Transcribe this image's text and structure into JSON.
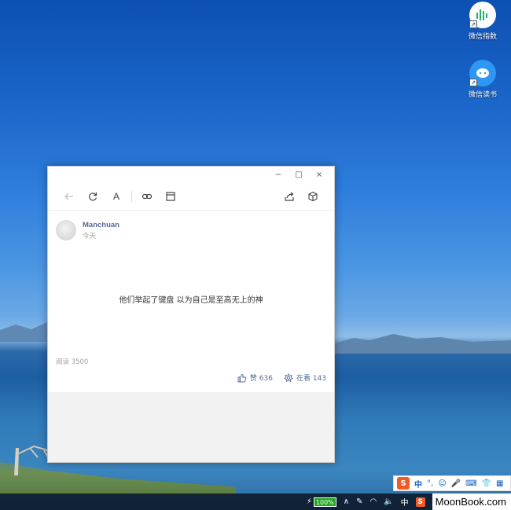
{
  "desktop": {
    "icons": [
      {
        "label": "微信指数",
        "icon": "wechat-index-icon"
      },
      {
        "label": "微信读书",
        "icon": "wechat-read-icon"
      }
    ]
  },
  "window": {
    "controls": {
      "minimize": "−",
      "maximize": "□",
      "close": "×"
    },
    "toolbar": {
      "back": "back-arrow-icon",
      "refresh": "refresh-icon",
      "font": "A",
      "link": "link-icon",
      "window": "window-icon",
      "share": "share-icon",
      "cube": "cube-icon"
    },
    "post": {
      "author": "Manchuan",
      "date": "今天",
      "text": "他们举起了键盘 以为自己是至高无上的神",
      "reads": "阅读 3500",
      "likes_label": "赞 636",
      "wow_label": "在看 143"
    }
  },
  "ime": {
    "logo": "S",
    "mode": "中",
    "items": [
      "°,",
      "☺",
      "🎤",
      "⌨",
      "👕",
      "▦"
    ]
  },
  "taskbar": {
    "battery": "100%",
    "lang": "中",
    "watermark": "MoonBook.com"
  },
  "colors": {
    "accent": "#576b95",
    "battery": "#1fa51f",
    "ime_logo": "#ef5b25"
  }
}
